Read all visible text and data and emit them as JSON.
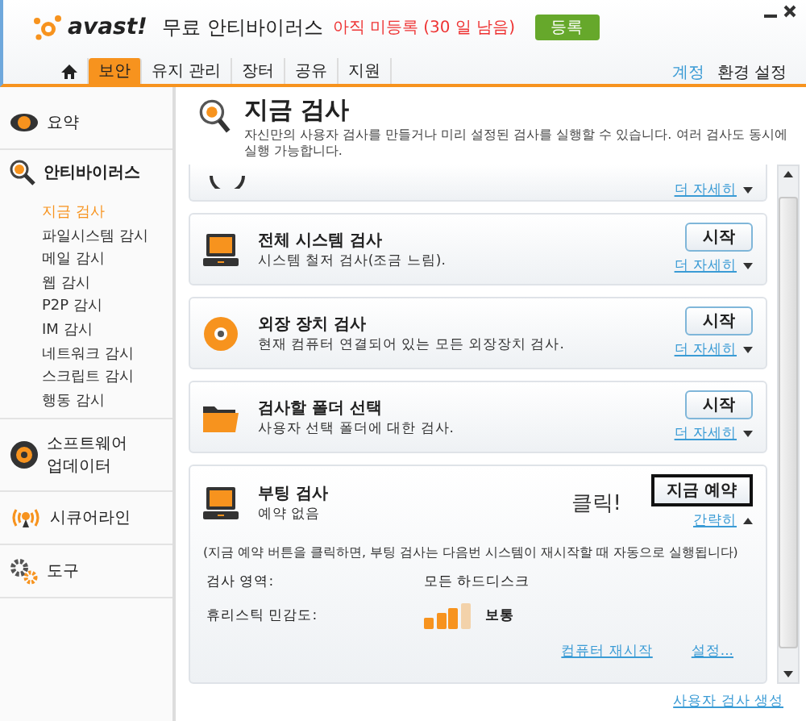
{
  "title_bar": {
    "brand": "avast!",
    "product": "무료 안티바이러스",
    "status": "아직 미등록 (30 일 남음)",
    "register_button": "등록"
  },
  "nav": {
    "tabs": [
      {
        "kind": "home",
        "selected": false
      },
      {
        "kind": "text",
        "label": "보안",
        "selected": true
      },
      {
        "kind": "text",
        "label": "유지 관리",
        "selected": false
      },
      {
        "kind": "text",
        "label": "장터",
        "selected": false
      },
      {
        "kind": "text",
        "label": "공유",
        "selected": false
      },
      {
        "kind": "text",
        "label": "지원",
        "selected": false
      }
    ],
    "links": [
      {
        "label": "계정",
        "kind": "link"
      },
      {
        "label": "환경 설정",
        "kind": "plain"
      }
    ]
  },
  "sidebar": {
    "sections": [
      {
        "label": "요약",
        "selected": false
      },
      {
        "label": "안티바이러스",
        "selected": true,
        "children": [
          {
            "label": "지금 검사",
            "selected": true
          },
          {
            "label": "파일시스템 감시",
            "selected": false
          },
          {
            "label": "메일 감시",
            "selected": false
          },
          {
            "label": "웹 감시",
            "selected": false
          },
          {
            "label": "P2P 감시",
            "selected": false
          },
          {
            "label": "IM 감시",
            "selected": false
          },
          {
            "label": "네트워크 감시",
            "selected": false
          },
          {
            "label": "스크립트 감시",
            "selected": false
          },
          {
            "label": "행동 감시",
            "selected": false
          }
        ]
      },
      {
        "label": "소프트웨어 업데이터",
        "selected": false
      },
      {
        "label": "시큐어라인",
        "selected": false
      },
      {
        "label": "도구",
        "selected": false
      }
    ]
  },
  "page": {
    "title": "지금 검사",
    "description": "자신만의 사용자 검사를 만들거나 미리 설정된 검사를 실행할 수 있습니다. 여러 검사도 동시에 실행 가능합니다."
  },
  "scans": [
    {
      "kind": "partial",
      "more_link": "더 자세히",
      "expanded": false
    },
    {
      "kind": "computer",
      "title": "전체 시스템 검사",
      "subtitle": "시스템 철저 검사(조금 느림).",
      "button": "시작",
      "more_link": "더 자세히",
      "expanded": false
    },
    {
      "kind": "disc",
      "title": "외장 장치 검사",
      "subtitle": "현재 컴퓨터 연결되어 있는 모든 외장장치 검사.",
      "button": "시작",
      "more_link": "더 자세히",
      "expanded": false
    },
    {
      "kind": "folder",
      "title": "검사할 폴더 선택",
      "subtitle": "사용자 선택 폴더에 대한 검사.",
      "button": "시작",
      "more_link": "더 자세히",
      "expanded": false
    },
    {
      "kind": "computer",
      "title": "부팅 검사",
      "subtitle": "예약 없음",
      "callout": "클릭!",
      "button": "지금 예약",
      "more_link": "간략히",
      "expanded": true,
      "details": {
        "note": "(지금 예약 버튼을 클릭하면, 부팅 검사는 다음번 시스템이 재시작할 때 자동으로 실행됩니다)",
        "area_label": "검사 영역:",
        "area_value": "모든 하드디스크",
        "sensitivity_label": "휴리스틱 민감도:",
        "sensitivity": {
          "level": 0.75,
          "value": "보통"
        },
        "links": [
          "컴퓨터 재시작",
          "설정..."
        ]
      }
    }
  ],
  "footer_link": "사용자 검사 생성"
}
